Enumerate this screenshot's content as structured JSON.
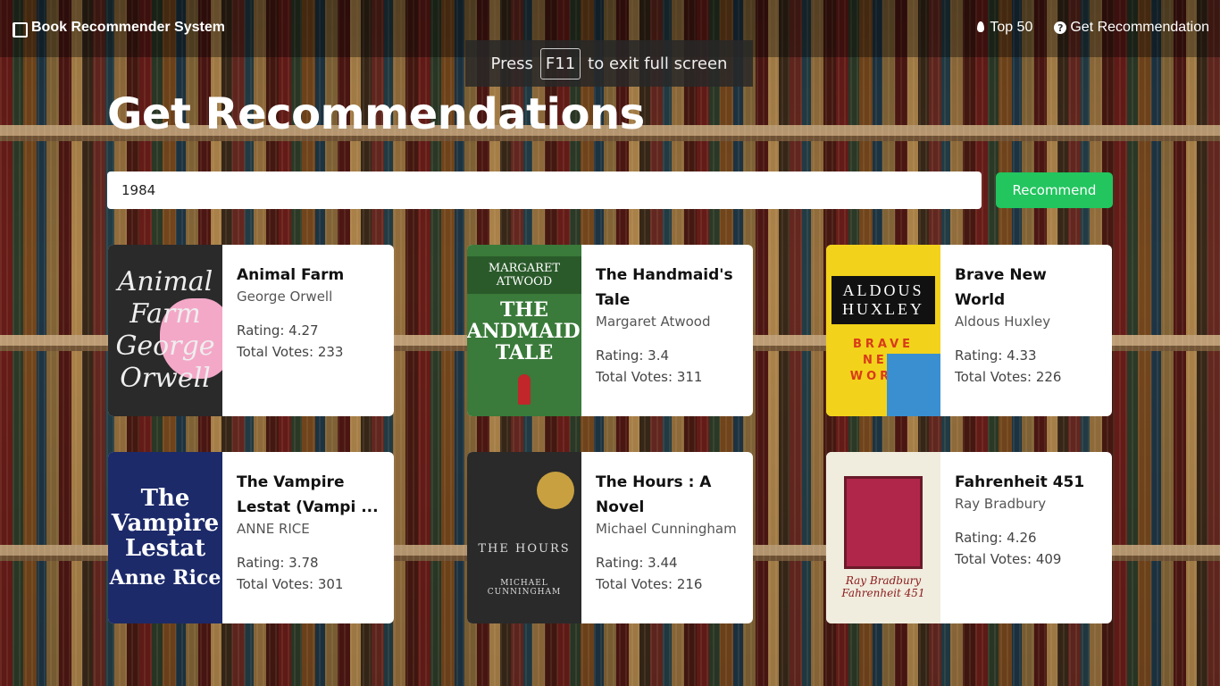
{
  "nav": {
    "brand": "Book Recommender System",
    "links": [
      {
        "label": "Top 50",
        "icon": "fire-icon"
      },
      {
        "label": "Get Recommendation",
        "icon": "question-circle-icon"
      }
    ]
  },
  "fullscreen_toast": {
    "before": "Press",
    "key": "F11",
    "after": "to exit full screen"
  },
  "page": {
    "title": "Get Recommendations"
  },
  "search": {
    "value": "1984",
    "button_label": "Recommend",
    "button_color": "#22c55e"
  },
  "books": [
    {
      "title": "Animal Farm",
      "author": "George Orwell",
      "rating": "Rating: 4.27",
      "votes": "Total Votes: 233",
      "cover": {
        "lines": [
          "Animal",
          "Farm",
          "George",
          "Orwell"
        ]
      }
    },
    {
      "title": "The Handmaid's Tale",
      "author": "Margaret Atwood",
      "rating": "Rating: 3.4",
      "votes": "Total Votes: 311",
      "cover": {
        "top": "MARGARET ATWOOD",
        "title": "THE HANDMAID'S TALE"
      }
    },
    {
      "title": "Brave New World",
      "author": "Aldous Huxley",
      "rating": "Rating: 4.33",
      "votes": "Total Votes: 226",
      "cover": {
        "author": "ALDOUS HUXLEY",
        "lines": [
          "BRAVE",
          "NEW",
          "WORLD"
        ]
      }
    },
    {
      "title": "The Vampire Lestat (Vampi ...",
      "author": "ANNE RICE",
      "rating": "Rating: 3.78",
      "votes": "Total Votes: 301",
      "cover": {
        "title": "The Vampire Lestat",
        "author": "Anne Rice"
      }
    },
    {
      "title": "The Hours : A Novel",
      "author": "Michael Cunningham",
      "rating": "Rating: 3.44",
      "votes": "Total Votes: 216",
      "cover": {
        "title": "THE HOURS",
        "author": "MICHAEL CUNNINGHAM"
      }
    },
    {
      "title": "Fahrenheit 451",
      "author": "Ray Bradbury",
      "rating": "Rating: 4.26",
      "votes": "Total Votes: 409",
      "cover": {
        "author": "Ray Bradbury",
        "title": "Fahrenheit 451"
      }
    }
  ]
}
